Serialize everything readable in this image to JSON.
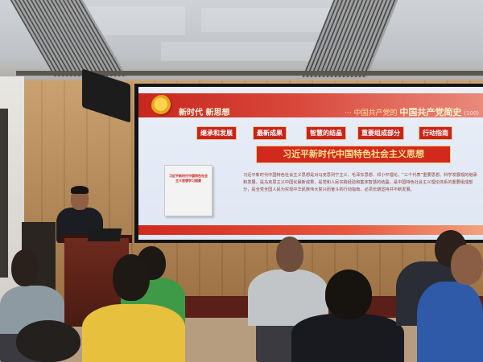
{
  "slide": {
    "header_left": "新时代 新思想",
    "header_right_prefix": "··· 中国共产党的",
    "header_right_main": "中国共产党简史",
    "header_right_suffix": "(100)",
    "tags": [
      "继承和发展",
      "最新成果",
      "智慧的结晶",
      "重要组成部分",
      "行动指南"
    ],
    "title": "习近平新时代中国特色社会主义思想",
    "book_title": "习近平新时代中国特色社会主义思想学习纲要",
    "body": "习近平新时代中国特色社会主义思想是对马克思列宁主义、毛泽东思想、邓小平理论、“三个代表”重要思想、科学发展观的继承和发展，是马克思主义中国化最新成果，是党和人民实践经验和集体智慧的结晶，是中国特色社会主义理论体系的重要组成部分，是全党全国人民为实现中华民族伟大复兴而奋斗的行动指南，必须长期坚持并不断发展。"
  },
  "colors": {
    "slide_red": "#c8271d",
    "slide_gold": "#ffe28a",
    "wood": "#b88a55"
  }
}
